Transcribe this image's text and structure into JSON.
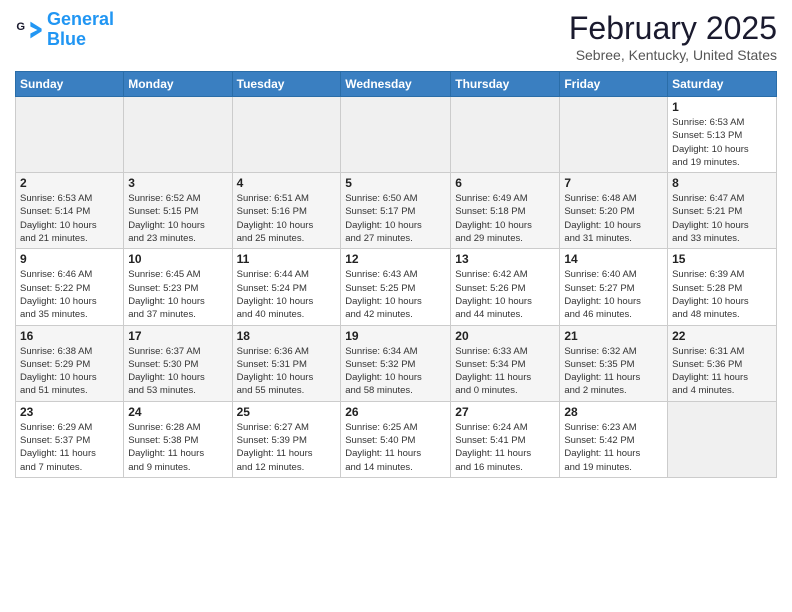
{
  "logo": {
    "line1": "General",
    "line2": "Blue"
  },
  "header": {
    "month": "February 2025",
    "location": "Sebree, Kentucky, United States"
  },
  "weekdays": [
    "Sunday",
    "Monday",
    "Tuesday",
    "Wednesday",
    "Thursday",
    "Friday",
    "Saturday"
  ],
  "weeks": [
    {
      "days": [
        {
          "num": "",
          "info": ""
        },
        {
          "num": "",
          "info": ""
        },
        {
          "num": "",
          "info": ""
        },
        {
          "num": "",
          "info": ""
        },
        {
          "num": "",
          "info": ""
        },
        {
          "num": "",
          "info": ""
        },
        {
          "num": "1",
          "info": "Sunrise: 6:53 AM\nSunset: 5:13 PM\nDaylight: 10 hours\nand 19 minutes."
        }
      ]
    },
    {
      "days": [
        {
          "num": "2",
          "info": "Sunrise: 6:53 AM\nSunset: 5:14 PM\nDaylight: 10 hours\nand 21 minutes."
        },
        {
          "num": "3",
          "info": "Sunrise: 6:52 AM\nSunset: 5:15 PM\nDaylight: 10 hours\nand 23 minutes."
        },
        {
          "num": "4",
          "info": "Sunrise: 6:51 AM\nSunset: 5:16 PM\nDaylight: 10 hours\nand 25 minutes."
        },
        {
          "num": "5",
          "info": "Sunrise: 6:50 AM\nSunset: 5:17 PM\nDaylight: 10 hours\nand 27 minutes."
        },
        {
          "num": "6",
          "info": "Sunrise: 6:49 AM\nSunset: 5:18 PM\nDaylight: 10 hours\nand 29 minutes."
        },
        {
          "num": "7",
          "info": "Sunrise: 6:48 AM\nSunset: 5:20 PM\nDaylight: 10 hours\nand 31 minutes."
        },
        {
          "num": "8",
          "info": "Sunrise: 6:47 AM\nSunset: 5:21 PM\nDaylight: 10 hours\nand 33 minutes."
        }
      ]
    },
    {
      "days": [
        {
          "num": "9",
          "info": "Sunrise: 6:46 AM\nSunset: 5:22 PM\nDaylight: 10 hours\nand 35 minutes."
        },
        {
          "num": "10",
          "info": "Sunrise: 6:45 AM\nSunset: 5:23 PM\nDaylight: 10 hours\nand 37 minutes."
        },
        {
          "num": "11",
          "info": "Sunrise: 6:44 AM\nSunset: 5:24 PM\nDaylight: 10 hours\nand 40 minutes."
        },
        {
          "num": "12",
          "info": "Sunrise: 6:43 AM\nSunset: 5:25 PM\nDaylight: 10 hours\nand 42 minutes."
        },
        {
          "num": "13",
          "info": "Sunrise: 6:42 AM\nSunset: 5:26 PM\nDaylight: 10 hours\nand 44 minutes."
        },
        {
          "num": "14",
          "info": "Sunrise: 6:40 AM\nSunset: 5:27 PM\nDaylight: 10 hours\nand 46 minutes."
        },
        {
          "num": "15",
          "info": "Sunrise: 6:39 AM\nSunset: 5:28 PM\nDaylight: 10 hours\nand 48 minutes."
        }
      ]
    },
    {
      "days": [
        {
          "num": "16",
          "info": "Sunrise: 6:38 AM\nSunset: 5:29 PM\nDaylight: 10 hours\nand 51 minutes."
        },
        {
          "num": "17",
          "info": "Sunrise: 6:37 AM\nSunset: 5:30 PM\nDaylight: 10 hours\nand 53 minutes."
        },
        {
          "num": "18",
          "info": "Sunrise: 6:36 AM\nSunset: 5:31 PM\nDaylight: 10 hours\nand 55 minutes."
        },
        {
          "num": "19",
          "info": "Sunrise: 6:34 AM\nSunset: 5:32 PM\nDaylight: 10 hours\nand 58 minutes."
        },
        {
          "num": "20",
          "info": "Sunrise: 6:33 AM\nSunset: 5:34 PM\nDaylight: 11 hours\nand 0 minutes."
        },
        {
          "num": "21",
          "info": "Sunrise: 6:32 AM\nSunset: 5:35 PM\nDaylight: 11 hours\nand 2 minutes."
        },
        {
          "num": "22",
          "info": "Sunrise: 6:31 AM\nSunset: 5:36 PM\nDaylight: 11 hours\nand 4 minutes."
        }
      ]
    },
    {
      "days": [
        {
          "num": "23",
          "info": "Sunrise: 6:29 AM\nSunset: 5:37 PM\nDaylight: 11 hours\nand 7 minutes."
        },
        {
          "num": "24",
          "info": "Sunrise: 6:28 AM\nSunset: 5:38 PM\nDaylight: 11 hours\nand 9 minutes."
        },
        {
          "num": "25",
          "info": "Sunrise: 6:27 AM\nSunset: 5:39 PM\nDaylight: 11 hours\nand 12 minutes."
        },
        {
          "num": "26",
          "info": "Sunrise: 6:25 AM\nSunset: 5:40 PM\nDaylight: 11 hours\nand 14 minutes."
        },
        {
          "num": "27",
          "info": "Sunrise: 6:24 AM\nSunset: 5:41 PM\nDaylight: 11 hours\nand 16 minutes."
        },
        {
          "num": "28",
          "info": "Sunrise: 6:23 AM\nSunset: 5:42 PM\nDaylight: 11 hours\nand 19 minutes."
        },
        {
          "num": "",
          "info": ""
        }
      ]
    }
  ]
}
